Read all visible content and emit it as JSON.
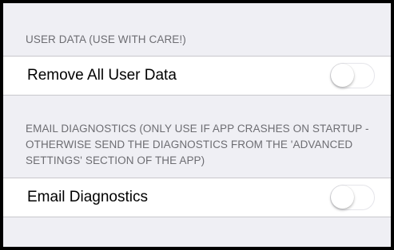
{
  "sections": [
    {
      "header": "USER DATA (USE WITH CARE!)",
      "row_label": "Remove All User Data",
      "toggle_on": false
    },
    {
      "header": "EMAIL DIAGNOSTICS (ONLY USE IF APP CRASHES ON STARTUP - OTHERWISE SEND THE DIAGNOSTICS FROM THE 'ADVANCED SETTINGS' SECTION OF THE APP)",
      "row_label": "Email Diagnostics",
      "toggle_on": false
    }
  ],
  "colors": {
    "background": "#efeff4",
    "header_text": "#6d6d72",
    "separator": "#c8c7cc",
    "toggle_off_border": "#e5e5ea"
  }
}
